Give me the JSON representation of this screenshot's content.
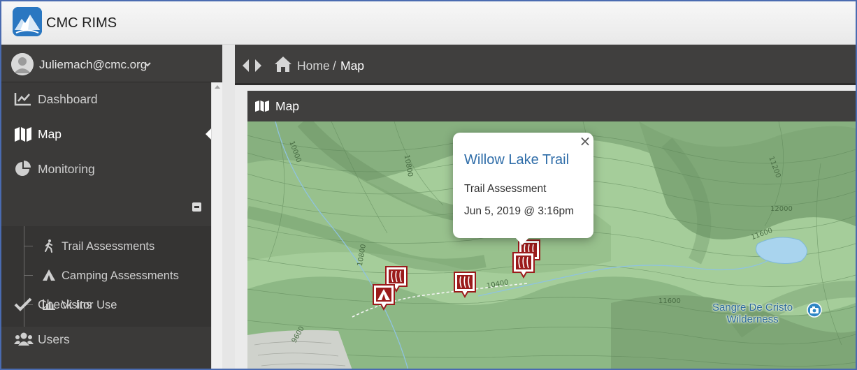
{
  "app": {
    "title": "CMC RIMS",
    "logo_icon": "mountain-logo-icon",
    "brand_color": "#2a77c1"
  },
  "user": {
    "email": "Juliemach@cmc.org",
    "avatar_icon": "user-avatar-icon",
    "menu_icon": "chevron-down-icon"
  },
  "sidebar": {
    "items": [
      {
        "label": "Dashboard",
        "icon": "chart-line-icon",
        "active": false
      },
      {
        "label": "Map",
        "icon": "map-icon",
        "active": true
      },
      {
        "label": "Monitoring",
        "icon": "pie-chart-icon",
        "active": false,
        "expanded": true
      },
      {
        "label": "Check Ins",
        "icon": "checkmark-icon",
        "active": false
      },
      {
        "label": "Users",
        "icon": "users-icon",
        "active": false
      }
    ],
    "monitoring_children": [
      {
        "label": "Trail Assessments",
        "icon": "hiker-icon"
      },
      {
        "label": "Camping Assessments",
        "icon": "tent-icon"
      },
      {
        "label": "Visitor Use",
        "icon": "bar-chart-icon"
      }
    ]
  },
  "breadcrumb": {
    "home": "Home",
    "separator": "/",
    "current": "Map"
  },
  "panel": {
    "title": "Map",
    "icon": "map-icon"
  },
  "map": {
    "popup": {
      "title": "Willow Lake Trail",
      "type": "Trail Assessment",
      "date": "Jun 5, 2019 @ 3:16pm",
      "close": "×"
    },
    "wilderness_label_line1": "Sangre De Cristo",
    "wilderness_label_line2": "Wilderness",
    "contour_labels": [
      "10000",
      "10800",
      "10800",
      "11200",
      "12000",
      "11600",
      "10400",
      "11600",
      "9600"
    ],
    "colors": {
      "marker_red": "#9b1b1b",
      "terrain_green": "#9fc897",
      "water_blue": "#a9d4ee"
    }
  }
}
